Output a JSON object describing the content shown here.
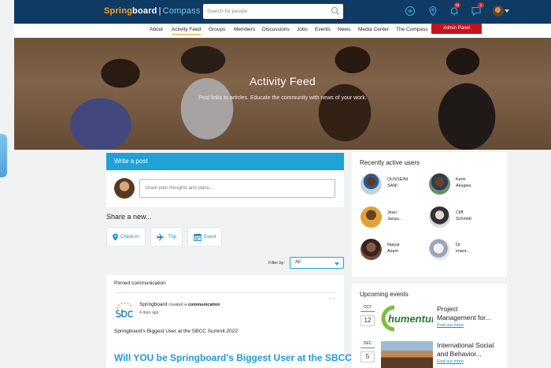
{
  "topbar": {
    "logo_part1": "Spring",
    "logo_part2": "board",
    "logo_part3": "Compass",
    "search_placeholder": "Search for people",
    "notification_count": "41",
    "message_count": "1"
  },
  "nav": {
    "items": [
      "About",
      "Activity Feed",
      "Groups",
      "Members",
      "Discussions",
      "Jobs",
      "Events",
      "News",
      "Media Center",
      "The Compass"
    ],
    "admin_label": "Admin Panel"
  },
  "hero": {
    "title": "Activity Feed",
    "subtitle": "Post links to articles. Educate the community with news of your work."
  },
  "write_post": {
    "title": "Write a post",
    "placeholder": "Share your thoughts and plans..."
  },
  "share": {
    "title": "Share a new...",
    "buttons": [
      "Check-in",
      "Trip",
      "Event"
    ]
  },
  "filter": {
    "label": "Filter by:",
    "value": "All"
  },
  "pinned": {
    "title": "Pinned communication",
    "author": "Springboard",
    "action": "created a",
    "object": "communication",
    "time": "4 days ago",
    "text": "Springboard's Biggest User at the SBCC Summit 2022",
    "headline": "Will YOU be Springboard's Biggest User at the SBCC"
  },
  "recent_users": {
    "title": "Recently active users",
    "users": [
      {
        "line1": "OUSSEINI",
        "line2": "SANI"
      },
      {
        "line1": "Kemi",
        "line2": "Akagwu"
      },
      {
        "line1": "Jean",
        "line2": "Jacqu..."
      },
      {
        "line1": "Cliff",
        "line2": "Schmidt"
      },
      {
        "line1": "Naiyar",
        "line2": "Azam"
      },
      {
        "line1": "Dr",
        "line2": "imani..."
      }
    ]
  },
  "events": {
    "title": "Upcoming events",
    "items": [
      {
        "month": "OCT",
        "day": "12",
        "title_line1": "Project",
        "title_line2": "Management for...",
        "link": "Find out more",
        "logo_text": "humentum"
      },
      {
        "month": "DEC",
        "day": "5",
        "title_line1": "International Social",
        "title_line2": "and Behavior...",
        "link": "Find out more"
      }
    ]
  }
}
